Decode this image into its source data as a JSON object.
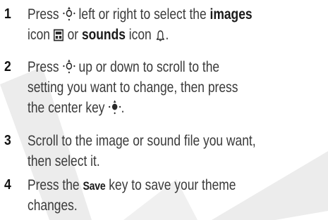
{
  "steps": [
    {
      "number": "1",
      "lines": [
        {
          "t1": "Press ",
          "t2": " left or right to select the ",
          "bold": "images"
        },
        {
          "t1": "icon ",
          "t2": " or ",
          "bold": "sounds",
          "t3": " icon ",
          "t4": "."
        }
      ]
    },
    {
      "number": "2",
      "lines": [
        {
          "t1": "Press ",
          "t2": " up or down to scroll to the"
        },
        {
          "t1": "setting you want to change, then press"
        },
        {
          "t1": "the center key ",
          "t2": "."
        }
      ]
    },
    {
      "number": "3",
      "lines": [
        {
          "t1": "Scroll to the image or sound file you want,"
        },
        {
          "t1": "then select it."
        }
      ]
    },
    {
      "number": "4",
      "lines": [
        {
          "t1": "Press the ",
          "softkey": "Save",
          "t2": " key to save your theme"
        },
        {
          "t1": "changes."
        }
      ]
    }
  ],
  "icons": {
    "nav_key": "nav-key-icon",
    "center_key": "center-key-icon",
    "images": "images-icon",
    "sounds": "sounds-bell-icon"
  },
  "colors": {
    "text": "#3a3a3a",
    "number": "#111111",
    "watermark": "#e9e9e9"
  }
}
